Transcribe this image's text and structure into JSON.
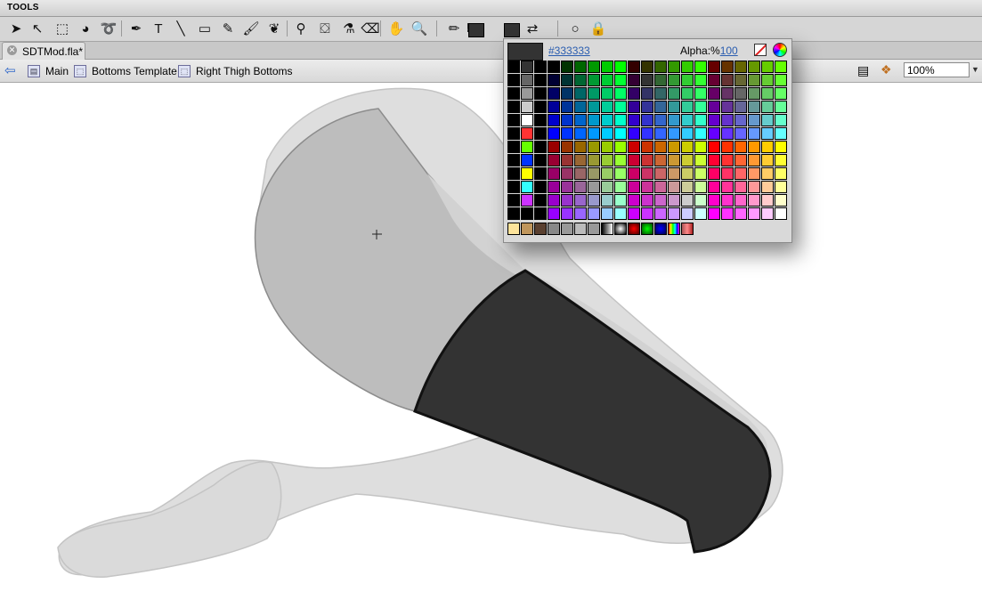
{
  "panel_title": "TOOLS",
  "tools": [
    {
      "icon": "selection-arrow-icon",
      "glyph": "➤"
    },
    {
      "icon": "subselection-arrow-icon",
      "glyph": "↖"
    },
    {
      "icon": "free-transform-icon",
      "glyph": "⬚"
    },
    {
      "icon": "3d-rotation-icon",
      "glyph": "◕"
    },
    {
      "icon": "lasso-icon",
      "glyph": "➰"
    },
    {
      "icon": "pen-icon",
      "glyph": "✒"
    },
    {
      "icon": "text-icon",
      "glyph": "T"
    },
    {
      "icon": "line-icon",
      "glyph": "╲"
    },
    {
      "icon": "rectangle-icon",
      "glyph": "▭"
    },
    {
      "icon": "pencil-icon",
      "glyph": "✎"
    },
    {
      "icon": "brush-icon",
      "glyph": "🖌"
    },
    {
      "icon": "deco-icon",
      "glyph": "❦"
    },
    {
      "icon": "bone-icon",
      "glyph": "⚲"
    },
    {
      "icon": "paint-bucket-icon",
      "glyph": "⛋"
    },
    {
      "icon": "eyedropper-icon",
      "glyph": "⚗"
    },
    {
      "icon": "eraser-icon",
      "glyph": "⌫"
    },
    {
      "icon": "hand-icon",
      "glyph": "✋"
    },
    {
      "icon": "zoom-icon",
      "glyph": "🔍"
    },
    {
      "icon": "stroke-color-icon",
      "glyph": "✏"
    },
    {
      "icon": "fill-color-icon",
      "glyph": "⛾"
    },
    {
      "icon": "swap-colors-icon",
      "glyph": "⇄"
    },
    {
      "icon": "object-drawing-icon",
      "glyph": "○"
    },
    {
      "icon": "snap-icon",
      "glyph": "🔒"
    }
  ],
  "document_tab": {
    "title": "SDTMod.fla*",
    "close_glyph": "✕"
  },
  "breadcrumb": {
    "back_glyph": "⇦",
    "items": [
      "Main",
      "Bottoms Template",
      "Right Thigh Bottoms"
    ]
  },
  "zoom": {
    "value": "100%",
    "caret": "▼"
  },
  "swatches": {
    "hex": "#333333",
    "alpha_label": "Alpha:%",
    "alpha_value": "100",
    "current_color": "#333333"
  },
  "colors": {
    "toolbar_bg": "#d6d6d6",
    "link": "#2a5db0",
    "shape_dark": "#333333",
    "shape_mid": "#bdbdbd",
    "shape_light": "#dedede"
  }
}
